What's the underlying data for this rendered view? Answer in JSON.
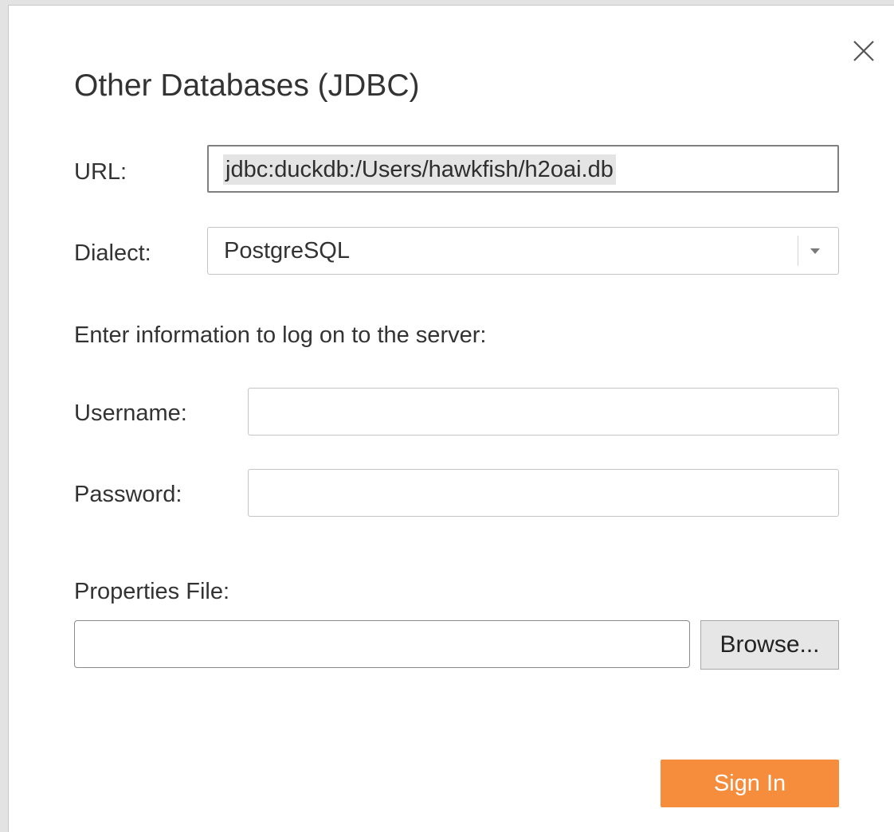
{
  "dialog": {
    "title": "Other Databases (JDBC)",
    "close_icon": "close-icon"
  },
  "url": {
    "label": "URL:",
    "value": "jdbc:duckdb:/Users/hawkfish/h2oai.db"
  },
  "dialect": {
    "label": "Dialect:",
    "selected": "PostgreSQL",
    "arrow_icon": "chevron-down-icon"
  },
  "login": {
    "instruction": "Enter information to log on to the server:",
    "username_label": "Username:",
    "username_value": "",
    "password_label": "Password:",
    "password_value": ""
  },
  "properties": {
    "label": "Properties File:",
    "value": "",
    "browse_label": "Browse..."
  },
  "actions": {
    "sign_in_label": "Sign In"
  },
  "colors": {
    "accent": "#f58d3d",
    "text": "#333333",
    "url_highlight": "#e4e4e4"
  }
}
